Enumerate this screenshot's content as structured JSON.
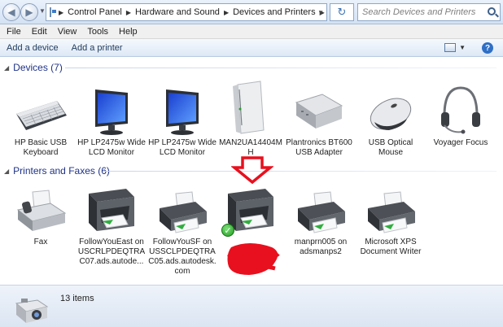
{
  "address": {
    "crumbs": [
      "Control Panel",
      "Hardware and Sound",
      "Devices and Printers"
    ],
    "search_placeholder": "Search Devices and Printers"
  },
  "menu": [
    "File",
    "Edit",
    "View",
    "Tools",
    "Help"
  ],
  "commands": {
    "add_device": "Add a device",
    "add_printer": "Add a printer",
    "help": "?"
  },
  "devices_group": {
    "title": "Devices (7)",
    "items": [
      {
        "label": "HP Basic USB Keyboard",
        "icon": "keyboard-icon"
      },
      {
        "label": "HP LP2475w Wide LCD Monitor",
        "icon": "monitor-icon"
      },
      {
        "label": "HP LP2475w Wide LCD Monitor",
        "icon": "monitor-icon"
      },
      {
        "label": "MAN2UA14404MH",
        "icon": "computer-tower-icon"
      },
      {
        "label": "Plantronics BT600 USB Adapter",
        "icon": "usb-adapter-icon"
      },
      {
        "label": "USB Optical Mouse",
        "icon": "mouse-icon"
      },
      {
        "label": "Voyager Focus",
        "icon": "headset-icon"
      }
    ]
  },
  "printers_group": {
    "title": "Printers and Faxes (6)",
    "items": [
      {
        "label": "Fax",
        "icon": "fax-icon"
      },
      {
        "label": "FollowYouEast on USCRLPDEQTRAC07.ads.autode...",
        "icon": "mfp-printer-icon"
      },
      {
        "label": "FollowYouSF on USSCLPDEQTRAC05.ads.autodesk.com",
        "icon": "printer-icon"
      },
      {
        "label": "",
        "icon": "mfp-printer-icon",
        "default": true
      },
      {
        "label": "manprn005 on adsmanps2",
        "icon": "printer-icon"
      },
      {
        "label": "Microsoft XPS Document Writer",
        "icon": "printer-icon"
      }
    ]
  },
  "status": {
    "text": "13 items"
  },
  "colors": {
    "group_header": "#1e3287",
    "annotation_red": "#e8101e"
  }
}
